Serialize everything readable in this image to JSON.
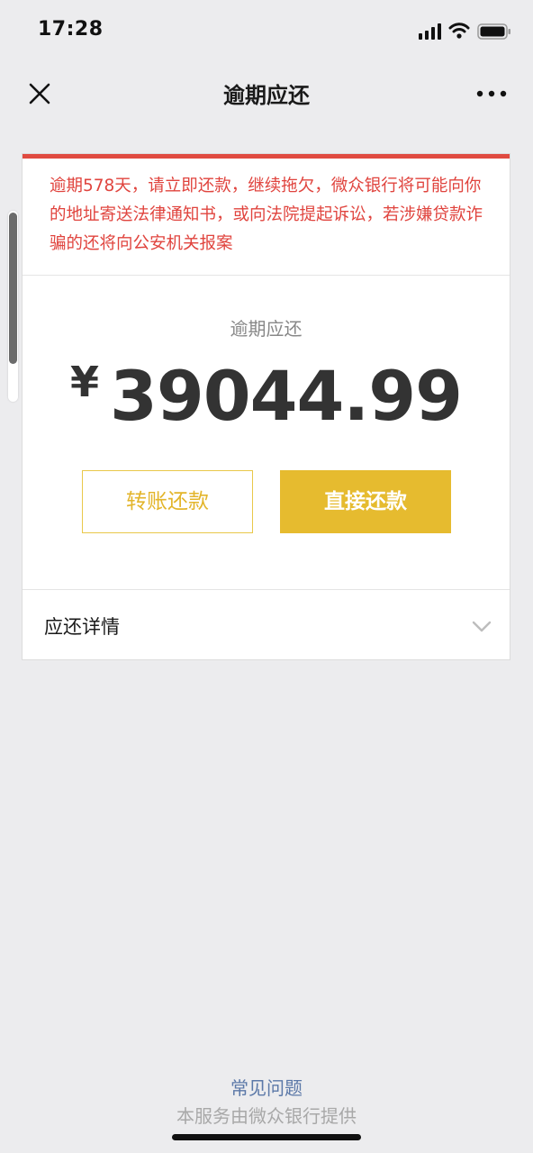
{
  "status_bar": {
    "time": "17:28"
  },
  "nav": {
    "title": "逾期应还",
    "close_icon": "close-icon",
    "more_icon": "more-icon"
  },
  "card": {
    "warning": "逾期578天，请立即还款，继续拖欠，微众银行将可能向你的地址寄送法律通知书，或向法院提起诉讼，若涉嫌贷款诈骗的还将向公安机关报案",
    "amount_label": "逾期应还",
    "currency": "¥",
    "amount": "39044.99",
    "transfer_button": "转账还款",
    "direct_button": "直接还款",
    "details_label": "应还详情"
  },
  "footer": {
    "faq": "常见问题",
    "note": "本服务由微众银行提供"
  },
  "colors": {
    "warning": "#e0443e",
    "accent": "#e6bb2f",
    "link": "#5b78a8"
  }
}
